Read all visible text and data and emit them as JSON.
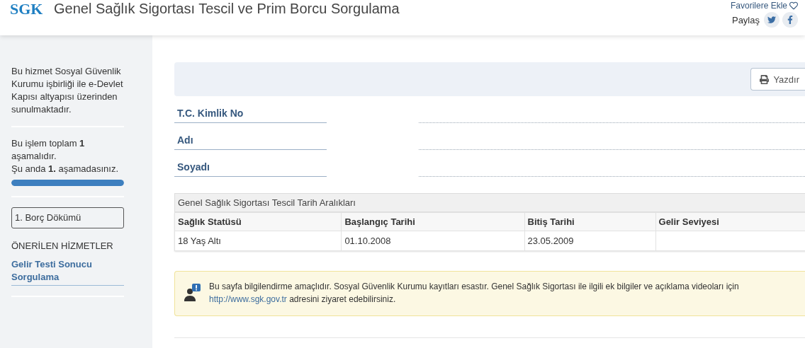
{
  "header": {
    "logo_text": "SGK",
    "title": "Genel Sağlık Sigortası Tescil ve Prim Borcu Sorgulama",
    "favorites": "Favorilere Ekle",
    "share_label": "Paylaş"
  },
  "sidebar": {
    "info": "Bu hizmet Sosyal Güvenlik Kurumu işbirliği ile e-Devlet Kapısı altyapısı üzerinden sunulmaktadır.",
    "steps_text": "Bu işlem toplam **1** aşamalıdır.",
    "current_text": "Şu anda **1.** aşamadasınız.",
    "progress": {
      "level": 1
    },
    "steps": [
      {
        "label": "1. Borç Dökümü",
        "selected": true
      }
    ],
    "recommended_title": "ÖNERİLEN HİZMETLER",
    "recommended_links": [
      "Gelir Testi Sonucu Sorgulama"
    ]
  },
  "toolbar": {
    "print_button": "Yazdır"
  },
  "fields": [
    {
      "label": "T.C. Kimlik No"
    },
    {
      "label": "Adı"
    },
    {
      "label": "Soyadı"
    }
  ],
  "table": {
    "caption": "Genel Sağlık Sigortası Tescil Tarih Aralıkları",
    "columns": [
      "Sağlık Statüsü",
      "Başlangıç Tarihi",
      "Bitiş Tarihi",
      "Gelir Seviyesi"
    ],
    "rows": [
      [
        "18 Yaş Altı",
        "01.10.2008",
        "23.05.2009",
        ""
      ]
    ]
  },
  "notice": {
    "text_before": "Bu sayfa bilgilendirme amaçlıdır. Sosyal Güvenlik Kurumu kayıtları esastır. Genel Sağlık Sigortası ile ilgili ek bilgiler ve açıklama videoları için",
    "link": "http://www.sgk.gov.tr",
    "text_after": "adresini ziyaret edebilirsiniz."
  }
}
